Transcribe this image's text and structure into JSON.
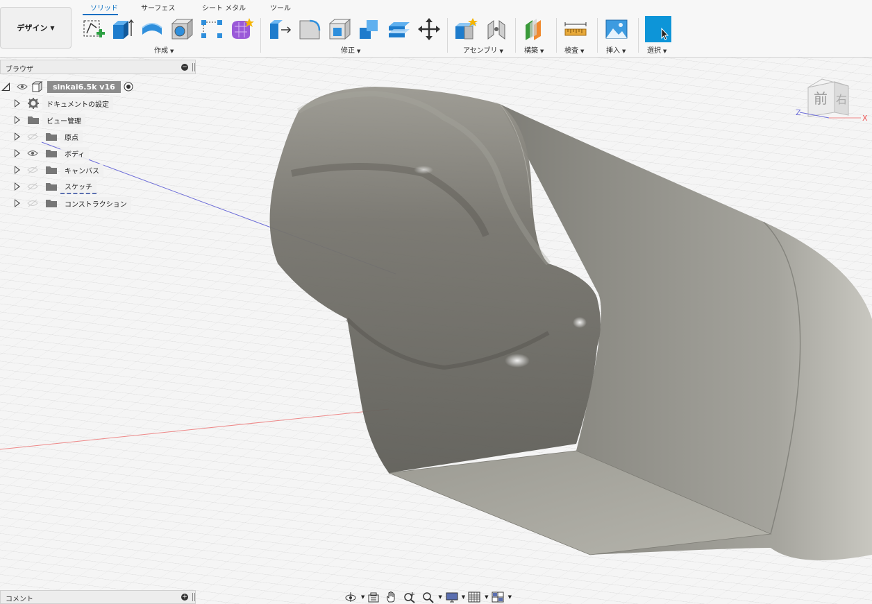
{
  "workspace": {
    "label": "デザイン"
  },
  "tabs": [
    {
      "label": "ソリッド",
      "active": true
    },
    {
      "label": "サーフェス",
      "active": false
    },
    {
      "label": "シート メタル",
      "active": false
    },
    {
      "label": "ツール",
      "active": false
    }
  ],
  "groups": {
    "create": "作成",
    "modify": "修正",
    "assemble": "アセンブリ",
    "construct": "構築",
    "inspect": "検査",
    "insert": "挿入",
    "select": "選択"
  },
  "browser": {
    "title": "ブラウザ",
    "root": "sinkai6.5k v16",
    "items": [
      {
        "label": "ドキュメントの設定",
        "icon": "gear-icon"
      },
      {
        "label": "ビュー管理",
        "icon": "folder-icon"
      },
      {
        "label": "原点",
        "icon": "folder-icon"
      },
      {
        "label": "ボディ",
        "icon": "folder-icon"
      },
      {
        "label": "キャンバス",
        "icon": "folder-icon"
      },
      {
        "label": "スケッチ",
        "icon": "folder-icon"
      },
      {
        "label": "コンストラクション",
        "icon": "folder-icon"
      }
    ]
  },
  "viewcube": {
    "front": "前",
    "right": "右",
    "axis_z": "Z",
    "axis_x": "X"
  },
  "comments": {
    "title": "コメント"
  },
  "colors": {
    "accent": "#0a6fc2",
    "select_bg": "#0d95d8",
    "model": "#8e8d86"
  }
}
